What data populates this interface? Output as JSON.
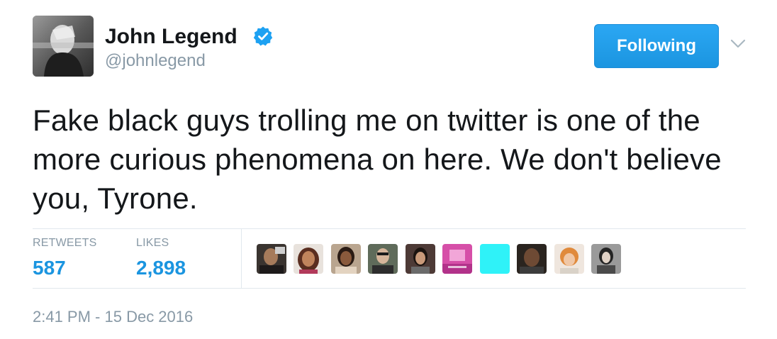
{
  "author": {
    "display_name": "John Legend",
    "username": "@johnlegend",
    "verified": true
  },
  "follow_button": {
    "label": "Following"
  },
  "tweet": {
    "text": "Fake black guys trolling me on twitter is one of the more curious phenomena on here.  We don't believe you, Tyrone."
  },
  "stats": {
    "retweets_label": "RETWEETS",
    "retweets_value": "587",
    "likes_label": "LIKES",
    "likes_value": "2,898"
  },
  "timestamp": "2:41 PM - 15 Dec 2016",
  "colors": {
    "accent": "#1da1f2",
    "link": "#1b95e0",
    "muted": "#8899a6",
    "divider": "#e1e8ed"
  },
  "icons": {
    "verified": "verified-badge-icon",
    "caret": "chevron-down-icon"
  }
}
